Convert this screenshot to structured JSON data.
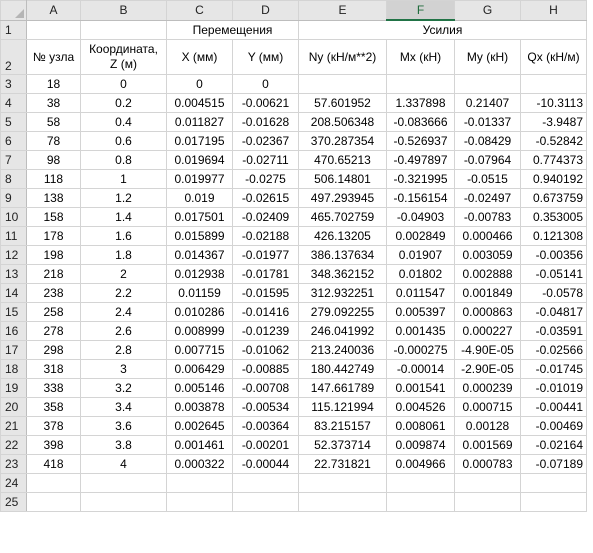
{
  "columns": [
    "A",
    "B",
    "C",
    "D",
    "E",
    "F",
    "G",
    "H"
  ],
  "selected_column": "F",
  "row_numbers": [
    "1",
    "2",
    "3",
    "4",
    "5",
    "6",
    "7",
    "8",
    "9",
    "10",
    "11",
    "12",
    "13",
    "14",
    "15",
    "16",
    "17",
    "18",
    "19",
    "20",
    "21",
    "22",
    "23",
    "24",
    "25"
  ],
  "row1": {
    "group_displacements": "Перемещения",
    "group_forces": "Усилия"
  },
  "row2": {
    "node_no": "№ узла",
    "coord_z": "Координата, Z (м)",
    "x_mm": "X (мм)",
    "y_mm": "Y (мм)",
    "ny": "Ny (кН/м**2)",
    "mx": "Mx (кН)",
    "my": "My (кН)",
    "qx": "Qx (кН/м)"
  },
  "rows": [
    [
      "18",
      "0",
      "0",
      "0",
      "",
      "",
      "",
      ""
    ],
    [
      "38",
      "0.2",
      "0.004515",
      "-0.00621",
      "57.601952",
      "1.337898",
      "0.21407",
      "-10.3113"
    ],
    [
      "58",
      "0.4",
      "0.011827",
      "-0.01628",
      "208.506348",
      "-0.083666",
      "-0.01337",
      "-3.9487"
    ],
    [
      "78",
      "0.6",
      "0.017195",
      "-0.02367",
      "370.287354",
      "-0.526937",
      "-0.08429",
      "-0.52842"
    ],
    [
      "98",
      "0.8",
      "0.019694",
      "-0.02711",
      "470.65213",
      "-0.497897",
      "-0.07964",
      "0.774373"
    ],
    [
      "118",
      "1",
      "0.019977",
      "-0.0275",
      "506.14801",
      "-0.321995",
      "-0.0515",
      "0.940192"
    ],
    [
      "138",
      "1.2",
      "0.019",
      "-0.02615",
      "497.293945",
      "-0.156154",
      "-0.02497",
      "0.673759"
    ],
    [
      "158",
      "1.4",
      "0.017501",
      "-0.02409",
      "465.702759",
      "-0.04903",
      "-0.00783",
      "0.353005"
    ],
    [
      "178",
      "1.6",
      "0.015899",
      "-0.02188",
      "426.13205",
      "0.002849",
      "0.000466",
      "0.121308"
    ],
    [
      "198",
      "1.8",
      "0.014367",
      "-0.01977",
      "386.137634",
      "0.01907",
      "0.003059",
      "-0.00356"
    ],
    [
      "218",
      "2",
      "0.012938",
      "-0.01781",
      "348.362152",
      "0.01802",
      "0.002888",
      "-0.05141"
    ],
    [
      "238",
      "2.2",
      "0.01159",
      "-0.01595",
      "312.932251",
      "0.011547",
      "0.001849",
      "-0.0578"
    ],
    [
      "258",
      "2.4",
      "0.010286",
      "-0.01416",
      "279.092255",
      "0.005397",
      "0.000863",
      "-0.04817"
    ],
    [
      "278",
      "2.6",
      "0.008999",
      "-0.01239",
      "246.041992",
      "0.001435",
      "0.000227",
      "-0.03591"
    ],
    [
      "298",
      "2.8",
      "0.007715",
      "-0.01062",
      "213.240036",
      "-0.000275",
      "-4.90E-05",
      "-0.02566"
    ],
    [
      "318",
      "3",
      "0.006429",
      "-0.00885",
      "180.442749",
      "-0.00014",
      "-2.90E-05",
      "-0.01745"
    ],
    [
      "338",
      "3.2",
      "0.005146",
      "-0.00708",
      "147.661789",
      "0.001541",
      "0.000239",
      "-0.01019"
    ],
    [
      "358",
      "3.4",
      "0.003878",
      "-0.00534",
      "115.121994",
      "0.004526",
      "0.000715",
      "-0.00441"
    ],
    [
      "378",
      "3.6",
      "0.002645",
      "-0.00364",
      "83.215157",
      "0.008061",
      "0.00128",
      "-0.00469"
    ],
    [
      "398",
      "3.8",
      "0.001461",
      "-0.00201",
      "52.373714",
      "0.009874",
      "0.001569",
      "-0.02164"
    ],
    [
      "418",
      "4",
      "0.000322",
      "-0.00044",
      "22.731821",
      "0.004966",
      "0.000783",
      "-0.07189"
    ]
  ],
  "colors": {
    "header_bg": "#e6e6e6",
    "selected_header_bg": "#d2d2d2",
    "accent": "#217346",
    "grid": "#d4d4d4"
  }
}
